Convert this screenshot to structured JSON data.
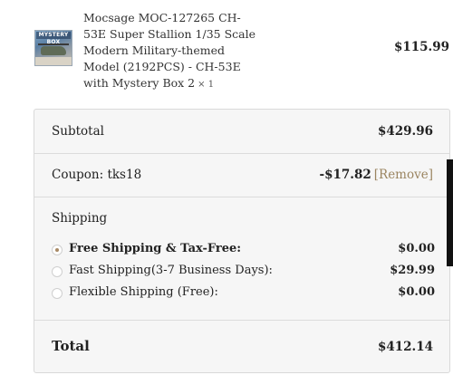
{
  "product": {
    "image_icon": "product-thumbnail",
    "image_caption": "MYSTERY BOX",
    "name": "Mocsage MOC-127265 CH-53E Super Stallion 1/35 Scale Modern Military-themed Model (2192PCS) - CH-53E with Mystery Box 2",
    "quantity": "× 1",
    "price": "$115.99"
  },
  "summary": {
    "subtotal_label": "Subtotal",
    "subtotal_value": "$429.96",
    "coupon_label": "Coupon: tks18",
    "coupon_value": "-$17.82",
    "coupon_remove": "[Remove]",
    "shipping_title": "Shipping",
    "shipping_options": [
      {
        "label": "Free Shipping & Tax-Free:",
        "value": "$0.00",
        "selected": true
      },
      {
        "label": "Fast Shipping(3-7 Business Days):",
        "value": "$29.99",
        "selected": false
      },
      {
        "label": "Flexible Shipping (Free):",
        "value": "$0.00",
        "selected": false
      }
    ],
    "total_label": "Total",
    "total_value": "$412.14"
  },
  "colors": {
    "accent_radio": "#a88a66",
    "remove_link": "#9b8561",
    "panel_bg": "#f6f6f6"
  }
}
